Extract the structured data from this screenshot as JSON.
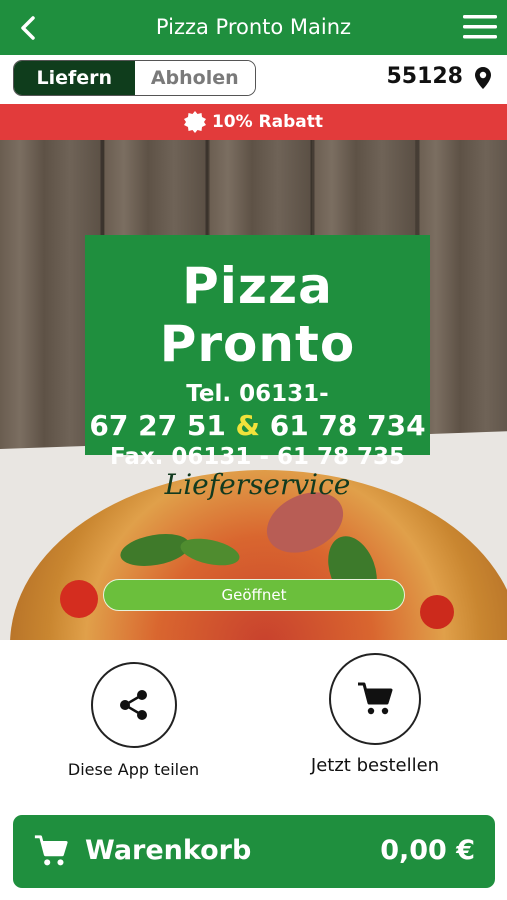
{
  "header": {
    "title": "Pizza Pronto Mainz",
    "back_icon": "chevron-left-icon",
    "menu_icon": "hamburger-menu-icon"
  },
  "mode": {
    "options": [
      "Liefern",
      "Abholen"
    ],
    "selected": "Liefern"
  },
  "location": {
    "zip": "55128",
    "icon": "map-pin-icon"
  },
  "promo": {
    "text": "10% Rabatt",
    "icon": "discount-badge-icon",
    "color": "#e23b3b"
  },
  "sign": {
    "name": "Pizza Pronto",
    "tel_label": "Tel. 06131-",
    "phone_1": "67 27 51",
    "amp": "&",
    "phone_2": "61 78 734",
    "fax": "Fax. 06131 - 61 78 735",
    "service": "Lieferservice"
  },
  "status": {
    "label": "Geöffnet",
    "color": "#6bbf3c"
  },
  "actions": [
    {
      "label": "Diese App teilen",
      "icon": "share-icon"
    },
    {
      "label": "Jetzt bestellen",
      "icon": "cart-icon"
    }
  ],
  "cart": {
    "label": "Warenkorb",
    "total": "0,00 €",
    "icon": "cart-icon"
  },
  "colors": {
    "brand": "#1f8f3e",
    "dark_green": "#0f3d1c",
    "promo_red": "#e23b3b"
  }
}
